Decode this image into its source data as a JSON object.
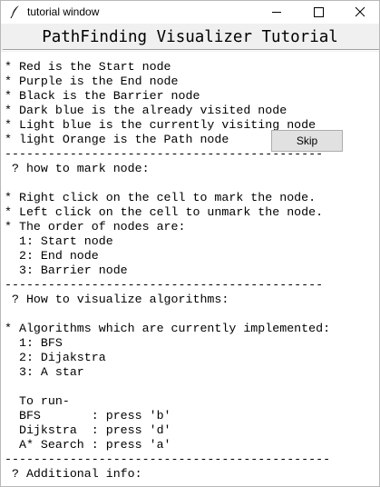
{
  "window": {
    "title": "tutorial window",
    "icon": "feather-icon",
    "controls": [
      "minimize-icon",
      "maximize-icon",
      "close-icon"
    ]
  },
  "heading": "PathFinding Visualizer Tutorial",
  "skip_button": "Skip",
  "tutorial_lines": [
    "* Red is the Start node",
    "* Purple is the End node",
    "* Black is the Barrier node",
    "* Dark blue is the already visited node",
    "* Light blue is the currently visiting node",
    "* light Orange is the Path node",
    "--------------------------------------------",
    " ? how to mark node:",
    "",
    "* Right click on the cell to mark the node.",
    "* Left click on the cell to unmark the node.",
    "* The order of nodes are:",
    "  1: Start node",
    "  2: End node",
    "  3: Barrier node",
    "--------------------------------------------",
    " ? How to visualize algorithms:",
    "",
    "* Algorithms which are currently implemented:",
    "  1: BFS",
    "  2: Dijakstra",
    "  3: A star",
    "",
    "  To run-",
    "  BFS       : press 'b'",
    "  Dijkstra  : press 'd'",
    "  A* Search : press 'a'",
    "---------------------------------------------",
    " ? Additional info:"
  ]
}
